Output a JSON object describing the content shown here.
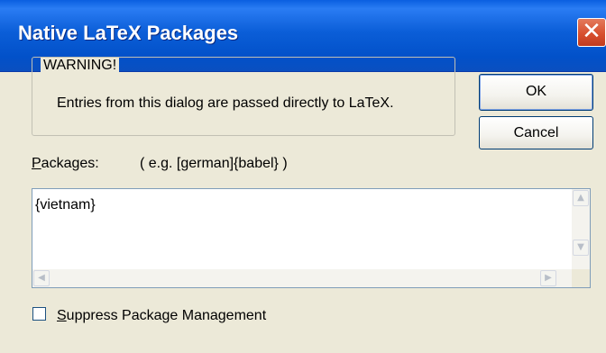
{
  "window": {
    "title": "Native LaTeX Packages",
    "close_glyph": "✕"
  },
  "warning": {
    "legend": "WARNING!",
    "message": "Entries from this dialog are passed directly to LaTeX."
  },
  "buttons": {
    "ok": "OK",
    "cancel": "Cancel"
  },
  "packages": {
    "label_mnemonic": "P",
    "label_rest": "ackages:",
    "hint": "( e.g. [german]{babel} )",
    "value": "{vietnam}"
  },
  "scrollbar": {
    "up_glyph": "▲",
    "down_glyph": "▼",
    "left_glyph": "◀",
    "right_glyph": "▶"
  },
  "suppress": {
    "label_mnemonic": "S",
    "label_rest": "uppress Package Management",
    "checked": false
  },
  "colors": {
    "titlebar": "#0b5ed8",
    "dialog_bg": "#ece9d8",
    "close_button": "#d8502f"
  }
}
